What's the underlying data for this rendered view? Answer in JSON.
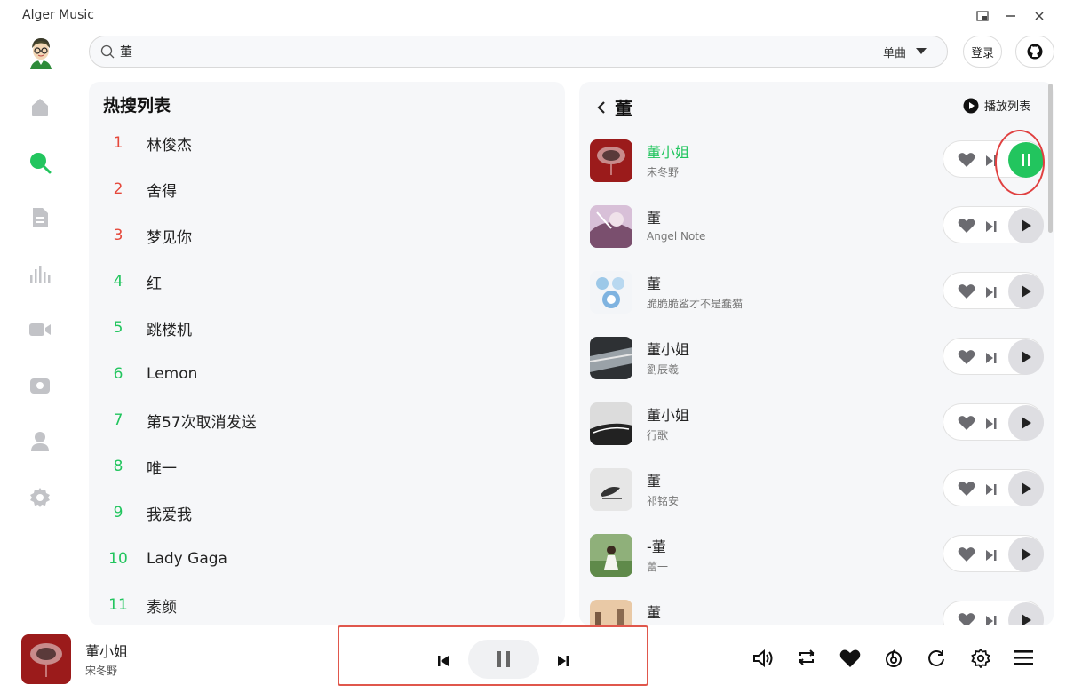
{
  "app": {
    "title": "Alger Music"
  },
  "window": {
    "pip_icon": "picture-in-picture-icon",
    "min_icon": "minimize-icon",
    "close_icon": "close-icon"
  },
  "search": {
    "value": "董",
    "placeholder": "",
    "type_label": "单曲"
  },
  "header": {
    "login_label": "登录",
    "github_icon": "github-icon"
  },
  "sidebar": {
    "items": [
      {
        "name": "home",
        "icon": "home-icon"
      },
      {
        "name": "search",
        "icon": "search-icon",
        "active": true
      },
      {
        "name": "list",
        "icon": "document-icon"
      },
      {
        "name": "chart",
        "icon": "bar-chart-icon"
      },
      {
        "name": "video",
        "icon": "video-icon"
      },
      {
        "name": "radio",
        "icon": "radio-icon"
      },
      {
        "name": "user",
        "icon": "user-icon"
      },
      {
        "name": "settings",
        "icon": "gear-icon"
      }
    ]
  },
  "hot": {
    "title": "热搜列表",
    "items": [
      {
        "rank": "1",
        "name": "林俊杰"
      },
      {
        "rank": "2",
        "name": "舍得"
      },
      {
        "rank": "3",
        "name": "梦见你"
      },
      {
        "rank": "4",
        "name": "红"
      },
      {
        "rank": "5",
        "name": "跳楼机"
      },
      {
        "rank": "6",
        "name": "Lemon"
      },
      {
        "rank": "7",
        "name": "第57次取消发送"
      },
      {
        "rank": "8",
        "name": "唯一"
      },
      {
        "rank": "9",
        "name": "我爱我"
      },
      {
        "rank": "10",
        "name": "Lady Gaga"
      },
      {
        "rank": "11",
        "name": "素颜"
      }
    ]
  },
  "results": {
    "back_title": "董",
    "playlist_label": "播放列表",
    "songs": [
      {
        "title": "董小姐",
        "artist": "宋冬野",
        "playing": true
      },
      {
        "title": "董",
        "artist": "Angel Note"
      },
      {
        "title": "董",
        "artist": "脆脆脆鲨才不是蠢猫"
      },
      {
        "title": "董小姐",
        "artist": "劉辰羲"
      },
      {
        "title": "董小姐",
        "artist": "行歌"
      },
      {
        "title": "董",
        "artist": "祁铭安"
      },
      {
        "title": "-董",
        "artist": "蕾一"
      },
      {
        "title": "董",
        "artist": ""
      }
    ]
  },
  "player": {
    "title": "董小姐",
    "artist": "宋冬野"
  },
  "colors": {
    "accent": "#22c55e",
    "hot_top": "#e5483b",
    "annotation": "#e0574c"
  }
}
